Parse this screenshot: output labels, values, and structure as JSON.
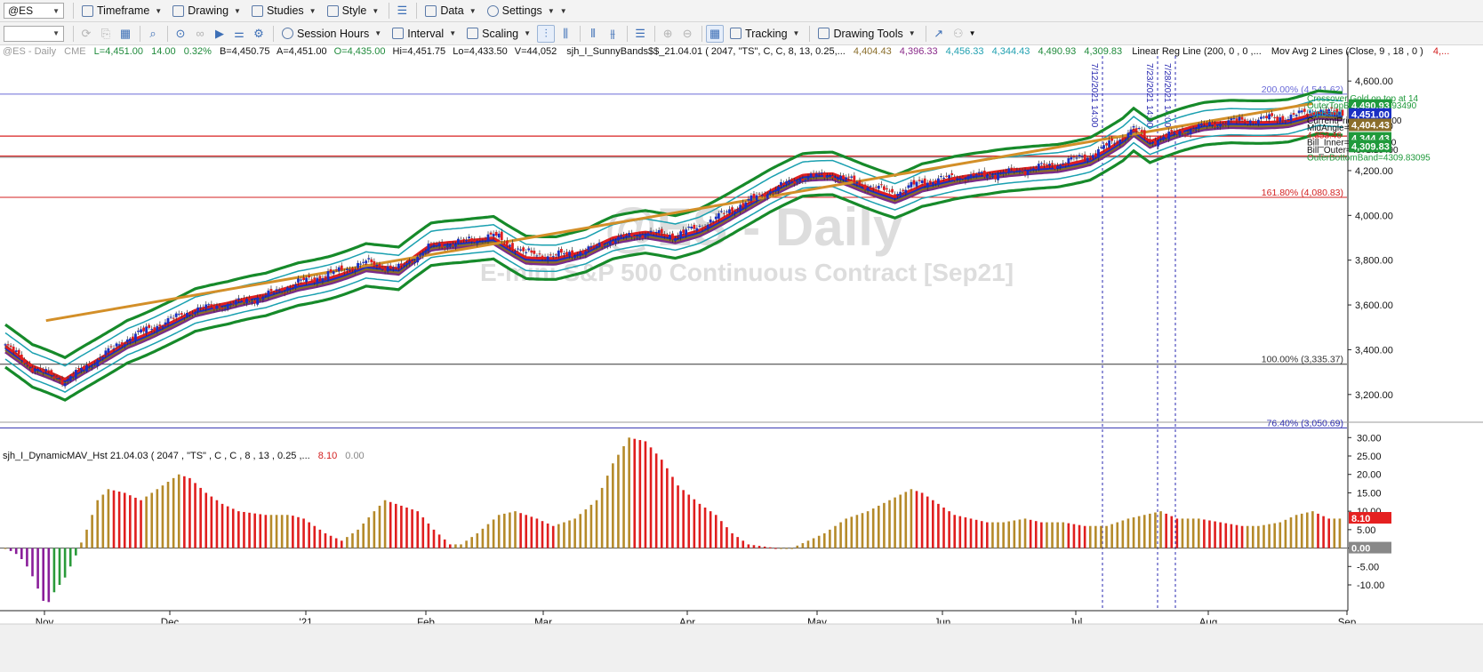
{
  "toolbar1": {
    "symbol": "@ES",
    "items": [
      "Timeframe",
      "Drawing",
      "Studies",
      "Style",
      "Data",
      "Settings"
    ]
  },
  "toolbar2": {
    "items": [
      "Session Hours",
      "Interval",
      "Scaling",
      "Tracking",
      "Drawing Tools"
    ]
  },
  "header_line": {
    "sym": "@ES - Daily",
    "exch": "CME",
    "last": "L=4,451.00",
    "chg": "14.00",
    "pct": "0.32%",
    "bid": "B=4,450.75",
    "ask": "A=4,451.00",
    "open": "O=4,435.00",
    "hi": "Hi=4,451.75",
    "lo": "Lo=4,433.50",
    "vol": "V=44,052",
    "study": "sjh_I_SunnyBands$$_21.04.01 ( 2047, \"TS\", C, C, 8, 13, 0.25,...",
    "v1": "4,404.43",
    "v2": "4,396.33",
    "v3": "4,456.33",
    "v4": "4,344.43",
    "v5": "4,490.93",
    "v6": "4,309.83",
    "lr": "Linear Reg Line (200, 0 , 0 ,...",
    "ma": "Mov Avg 2 Lines (Close, 9 , 18 , 0 )",
    "trail": "4,..."
  },
  "watermark": {
    "big": "@ES - Daily",
    "sub": "E-mini S&P 500 Continuous Contract [Sep21]"
  },
  "price_axis": [
    "4,600.00",
    "4,400.00",
    "4,200.00",
    "4,000.00",
    "3,800.00",
    "3,600.00",
    "3,400.00",
    "3,200.00"
  ],
  "price_flags": [
    {
      "text": "4,490.93",
      "color": "#1f9a3b",
      "v": 4490.93
    },
    {
      "text": "4,451.00",
      "color": "#1a2fc4",
      "v": 4451.0
    },
    {
      "text": "4,404.43",
      "color": "#8a6d2a",
      "v": 4404.43
    },
    {
      "text": "4,344.43",
      "color": "#1f9a3b",
      "v": 4344.43
    },
    {
      "text": "4,309.83",
      "color": "#1f9a3b",
      "v": 4309.83
    }
  ],
  "fib_levels": [
    {
      "label": "200.00% (4,541.62)",
      "v": 4541.62,
      "color": "#6a6ad8"
    },
    {
      "label": "161.80% (4,080.83)",
      "v": 4080.83,
      "color": "#d32020"
    },
    {
      "label": "100.00% (3,335.37)",
      "v": 3335.37,
      "color": "#333333"
    },
    {
      "label": "76.40% (3,050.69)",
      "v": 3050.69,
      "color": "#3030b0"
    }
  ],
  "red_hlines": [
    4354,
    4265
  ],
  "right_labels": [
    {
      "text": "Crossover Gold on top at 14",
      "color": "#1f9a3b"
    },
    {
      "text": "OuterTopBand=4490.93490",
      "color": "#1f9a3b"
    },
    {
      "text": "TopBand",
      "color": "#20b0c0"
    },
    {
      "text": "CurrentPrice= 4451.000",
      "color": "#111111"
    },
    {
      "text": "MidAngle= 67.71",
      "color": "#111111"
    },
    {
      "text": "4,353.46",
      "color": "#d32020"
    },
    {
      "text": "Bill_Inner=4381.30490",
      "color": "#111111"
    },
    {
      "text": "Bill_Outer=4371.10490",
      "color": "#111111"
    },
    {
      "text": "OuterBottomBand=4309.83095",
      "color": "#1f9a3b"
    }
  ],
  "vlines": [
    "7/12/2021 14:00",
    "7/23/2021 14:00",
    "7/28/2021 14:00"
  ],
  "x_labels": [
    "Nov",
    "Dec",
    "'21",
    "Feb",
    "Mar",
    "Apr",
    "May",
    "Jun",
    "Jul",
    "Aug",
    "Sep"
  ],
  "sub_title": "sjh_I_DynamicMAV_Hst 21.04.03 ( 2047 , \"TS\" , C , C , 8 , 13 , 0.25 ,...",
  "sub_v1": "8.10",
  "sub_v2": "0.00",
  "sub_axis": [
    "30.00",
    "25.00",
    "20.00",
    "15.00",
    "10.00",
    "5.00",
    "0.00",
    "-5.00",
    "-10.00"
  ],
  "sub_flags": [
    {
      "text": "8.10",
      "color": "#e52020",
      "v": 8.1
    },
    {
      "text": "0.00",
      "color": "#888888",
      "v": 0
    }
  ],
  "chart_data": {
    "type": "candlestick",
    "symbol": "@ES",
    "interval": "Daily",
    "price_range": [
      3100,
      4700
    ],
    "anchors": [
      [
        0,
        3420
      ],
      [
        10,
        3320
      ],
      [
        22,
        3260
      ],
      [
        33,
        3350
      ],
      [
        45,
        3450
      ],
      [
        58,
        3520
      ],
      [
        70,
        3580
      ],
      [
        82,
        3600
      ],
      [
        96,
        3640
      ],
      [
        108,
        3700
      ],
      [
        120,
        3740
      ],
      [
        133,
        3790
      ],
      [
        145,
        3760
      ],
      [
        157,
        3860
      ],
      [
        168,
        3880
      ],
      [
        180,
        3910
      ],
      [
        192,
        3830
      ],
      [
        203,
        3820
      ],
      [
        214,
        3840
      ],
      [
        224,
        3890
      ],
      [
        236,
        3920
      ],
      [
        247,
        3910
      ],
      [
        256,
        3950
      ],
      [
        270,
        4040
      ],
      [
        282,
        4110
      ],
      [
        294,
        4170
      ],
      [
        305,
        4180
      ],
      [
        316,
        4140
      ],
      [
        328,
        4100
      ],
      [
        338,
        4150
      ],
      [
        350,
        4170
      ],
      [
        362,
        4180
      ],
      [
        374,
        4200
      ],
      [
        388,
        4230
      ],
      [
        400,
        4270
      ],
      [
        412,
        4350
      ],
      [
        416,
        4390
      ],
      [
        422,
        4330
      ],
      [
        433,
        4370
      ],
      [
        442,
        4400
      ],
      [
        452,
        4420
      ],
      [
        463,
        4430
      ],
      [
        473,
        4440
      ],
      [
        484,
        4470
      ],
      [
        493,
        4451
      ]
    ],
    "histogram": [
      [
        0,
        0
      ],
      [
        5,
        -2
      ],
      [
        9,
        -6
      ],
      [
        12,
        -11
      ],
      [
        15,
        -16
      ],
      [
        18,
        -12
      ],
      [
        22,
        -8
      ],
      [
        26,
        -2
      ],
      [
        30,
        5
      ],
      [
        34,
        13
      ],
      [
        38,
        16
      ],
      [
        44,
        15
      ],
      [
        50,
        13
      ],
      [
        58,
        17
      ],
      [
        64,
        20
      ],
      [
        68,
        19
      ],
      [
        74,
        15
      ],
      [
        80,
        12
      ],
      [
        86,
        10
      ],
      [
        96,
        9
      ],
      [
        105,
        9
      ],
      [
        110,
        8
      ],
      [
        118,
        4
      ],
      [
        124,
        2
      ],
      [
        130,
        5
      ],
      [
        136,
        10
      ],
      [
        140,
        13
      ],
      [
        144,
        12
      ],
      [
        152,
        10
      ],
      [
        158,
        5
      ],
      [
        164,
        1
      ],
      [
        168,
        1
      ],
      [
        174,
        4
      ],
      [
        182,
        9
      ],
      [
        188,
        10
      ],
      [
        196,
        8
      ],
      [
        202,
        6
      ],
      [
        210,
        8
      ],
      [
        218,
        13
      ],
      [
        224,
        23
      ],
      [
        230,
        30
      ],
      [
        236,
        29
      ],
      [
        242,
        24
      ],
      [
        248,
        17
      ],
      [
        256,
        12
      ],
      [
        262,
        9
      ],
      [
        268,
        4
      ],
      [
        274,
        1
      ],
      [
        284,
        0
      ],
      [
        290,
        0
      ],
      [
        296,
        2
      ],
      [
        302,
        4
      ],
      [
        310,
        8
      ],
      [
        318,
        10
      ],
      [
        326,
        13
      ],
      [
        334,
        16
      ],
      [
        338,
        15
      ],
      [
        344,
        12
      ],
      [
        350,
        9
      ],
      [
        356,
        8
      ],
      [
        362,
        7
      ],
      [
        368,
        7
      ],
      [
        376,
        8
      ],
      [
        382,
        7
      ],
      [
        390,
        7
      ],
      [
        398,
        6
      ],
      [
        406,
        6
      ],
      [
        414,
        8
      ],
      [
        420,
        9
      ],
      [
        426,
        10
      ],
      [
        432,
        8
      ],
      [
        440,
        8
      ],
      [
        448,
        7
      ],
      [
        456,
        6
      ],
      [
        462,
        6
      ],
      [
        470,
        7
      ],
      [
        476,
        9
      ],
      [
        482,
        10
      ],
      [
        488,
        8
      ],
      [
        493,
        8
      ]
    ],
    "sub_range": [
      -17,
      32
    ]
  }
}
